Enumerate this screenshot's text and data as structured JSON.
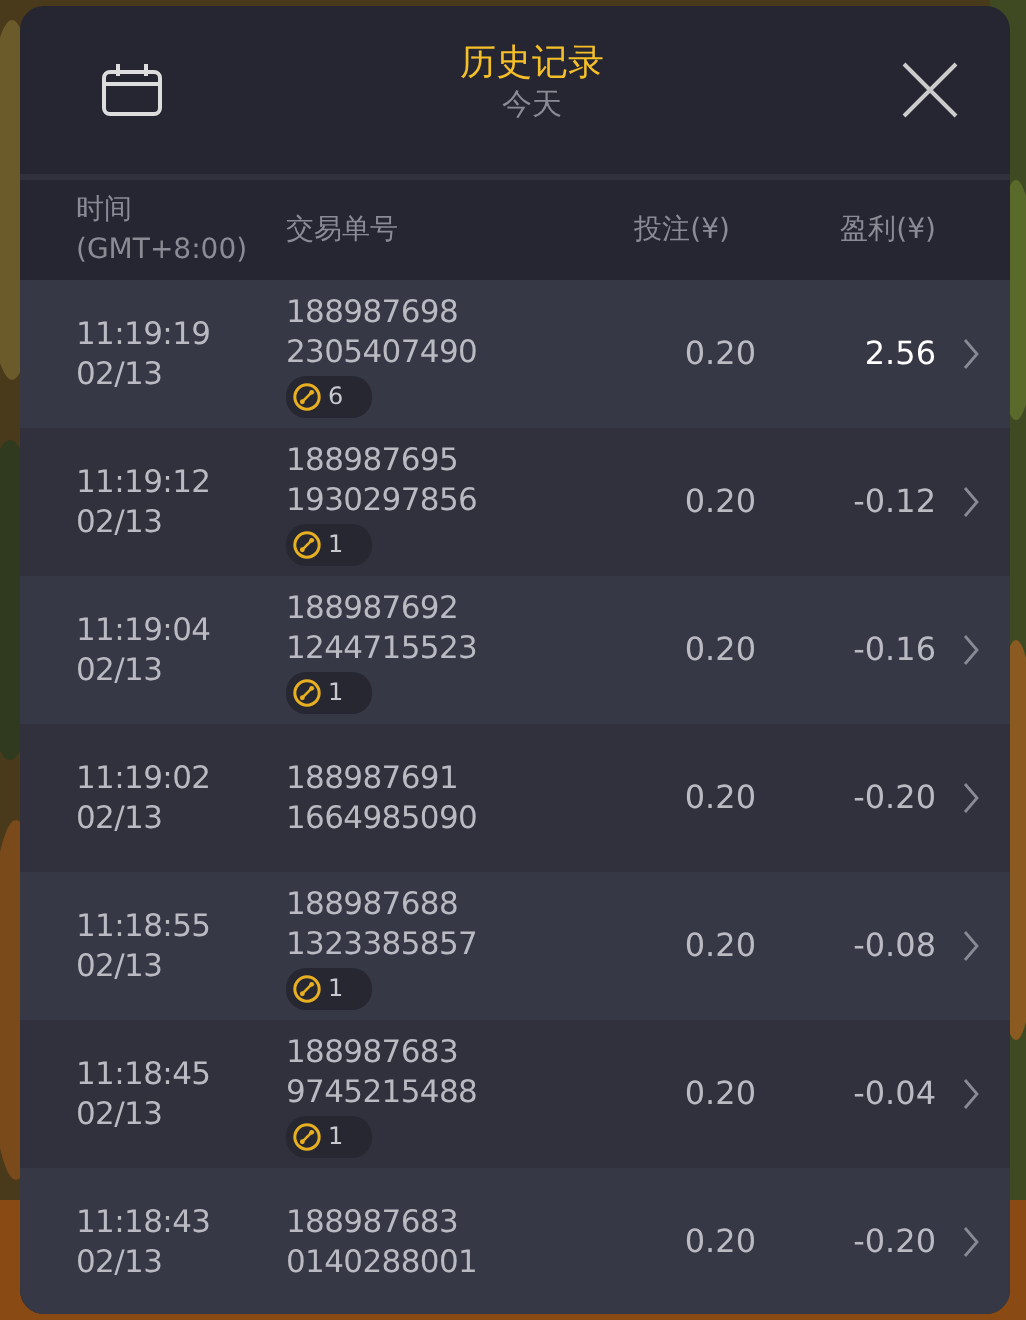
{
  "header": {
    "title": "历史记录",
    "subtitle": "今天"
  },
  "columns": [
    {
      "label": "时间\n(GMT+8:00)"
    },
    {
      "label": "交易单号"
    },
    {
      "label": "投注(¥)"
    },
    {
      "label": "盈利(¥)"
    }
  ],
  "rows": [
    {
      "time": "11:19:19",
      "date": "02/13",
      "order_line_1": "188987698",
      "order_line_2": "2305407490",
      "badge_count": "6",
      "bet": "0.20",
      "profit": "2.56",
      "profit_highlighted": true
    },
    {
      "time": "11:19:12",
      "date": "02/13",
      "order_line_1": "188987695",
      "order_line_2": "1930297856",
      "badge_count": "1",
      "bet": "0.20",
      "profit": "-0.12",
      "profit_highlighted": false
    },
    {
      "time": "11:19:04",
      "date": "02/13",
      "order_line_1": "188987692",
      "order_line_2": "1244715523",
      "badge_count": "1",
      "bet": "0.20",
      "profit": "-0.16",
      "profit_highlighted": false
    },
    {
      "time": "11:19:02",
      "date": "02/13",
      "order_line_1": "188987691",
      "order_line_2": "1664985090",
      "bet": "0.20",
      "profit": "-0.20",
      "profit_highlighted": false
    },
    {
      "time": "11:18:55",
      "date": "02/13",
      "order_line_1": "188987688",
      "order_line_2": "1323385857",
      "badge_count": "1",
      "bet": "0.20",
      "profit": "-0.08",
      "profit_highlighted": false
    },
    {
      "time": "11:18:45",
      "date": "02/13",
      "order_line_1": "188987683",
      "order_line_2": "9745215488",
      "badge_count": "1",
      "bet": "0.20",
      "profit": "-0.04",
      "profit_highlighted": false
    },
    {
      "time": "11:18:43",
      "date": "02/13",
      "order_line_1": "188987683",
      "order_line_2": "0140288001",
      "bet": "0.20",
      "profit": "-0.20",
      "profit_highlighted": false
    }
  ]
}
